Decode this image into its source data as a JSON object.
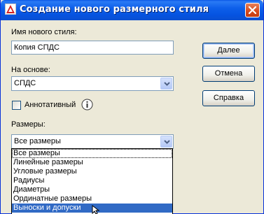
{
  "window": {
    "title": "Создание нового размерного стиля",
    "app_icon": "autocad-icon",
    "close_icon": "close-icon"
  },
  "form": {
    "new_style_label": "Имя нового стиля:",
    "new_style_value": "Копия СПДС",
    "based_on_label": "На основе:",
    "based_on_value": "СПДС",
    "annotative_label": "Аннотативный",
    "annotative_checked": false,
    "info_icon": "info-icon",
    "dimensions_label": "Размеры:",
    "dimensions_value": "Все размеры"
  },
  "buttons": {
    "continue": "Далее",
    "cancel": "Отмена",
    "help": "Справка"
  },
  "dimensions_dropdown": {
    "open": true,
    "items": [
      "Все размеры",
      "Линейные размеры",
      "Угловые размеры",
      "Радиусы",
      "Диаметры",
      "Ординатные размеры",
      "Выноски и допуски"
    ],
    "highlighted": "Выноски и допуски"
  },
  "colors": {
    "title_bar": "#0a58e6",
    "dialog_bg": "#ece9d8",
    "selection": "#316ac5",
    "close_button": "#d5491c"
  }
}
